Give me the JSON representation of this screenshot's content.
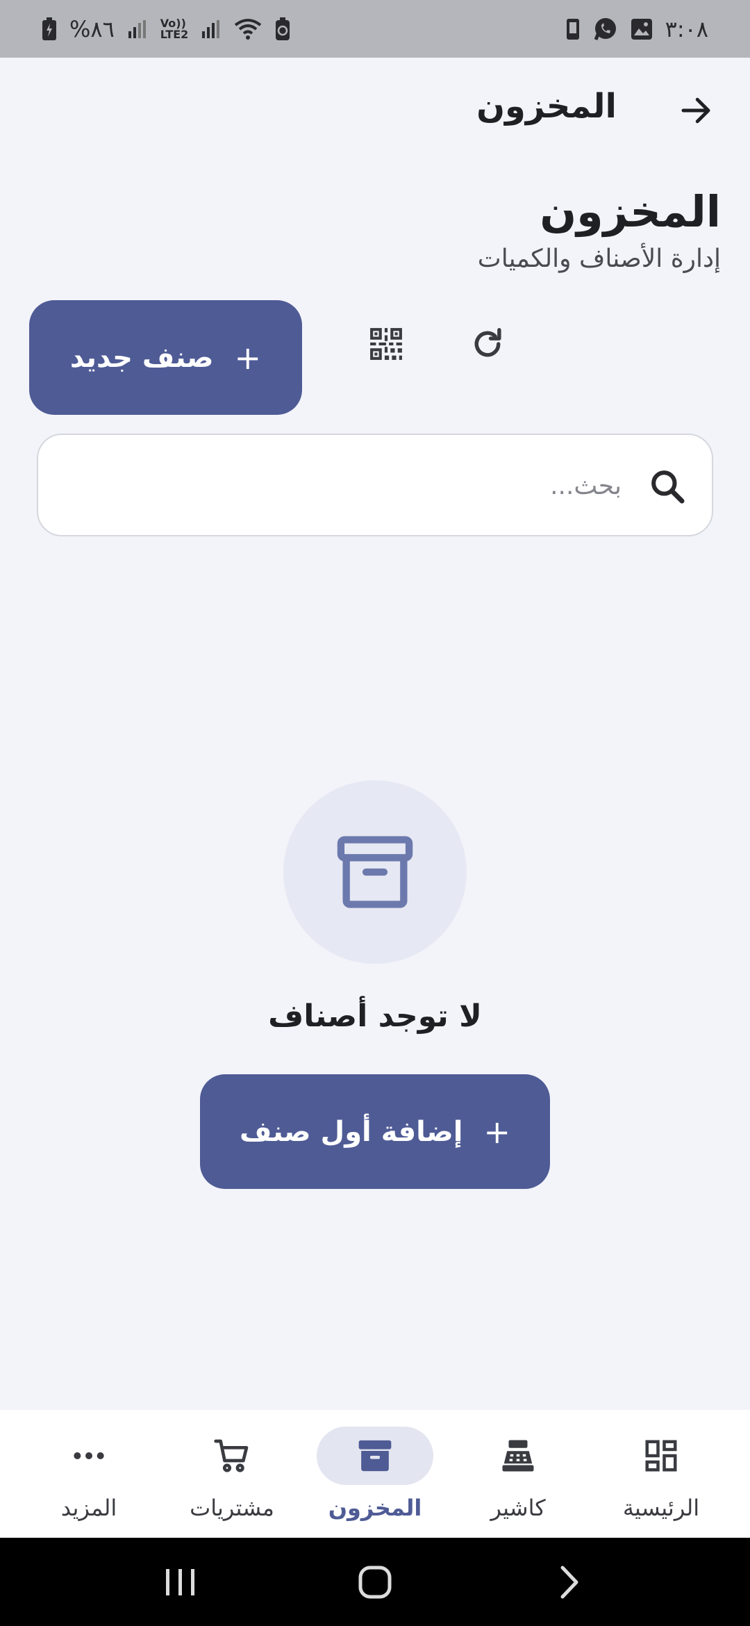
{
  "status_bar": {
    "time": "٣:٠٨",
    "battery": "%٨٦",
    "network": "Vo)) LTE2"
  },
  "header": {
    "title": "المخزون"
  },
  "page": {
    "title": "المخزون",
    "subtitle": "إدارة الأصناف والكميات"
  },
  "actions": {
    "new_item_label": "صنف جديد",
    "plus_symbol": "+"
  },
  "search": {
    "placeholder": "بحث...",
    "value": ""
  },
  "empty_state": {
    "message": "لا توجد أصناف",
    "add_first_label": "إضافة أول صنف",
    "plus_symbol": "+"
  },
  "bottom_nav": {
    "items": [
      {
        "label": "الرئيسية",
        "icon": "dashboard-icon",
        "active": false
      },
      {
        "label": "كاشير",
        "icon": "cash-register-icon",
        "active": false
      },
      {
        "label": "المخزون",
        "icon": "archive-icon",
        "active": true
      },
      {
        "label": "مشتريات",
        "icon": "cart-icon",
        "active": false
      },
      {
        "label": "المزيد",
        "icon": "more-icon",
        "active": false
      }
    ]
  },
  "colors": {
    "primary": "#4f5b95",
    "background": "#f3f4fa",
    "status_bar": "#b5b6bb",
    "active_pill": "#e3e5f0"
  }
}
